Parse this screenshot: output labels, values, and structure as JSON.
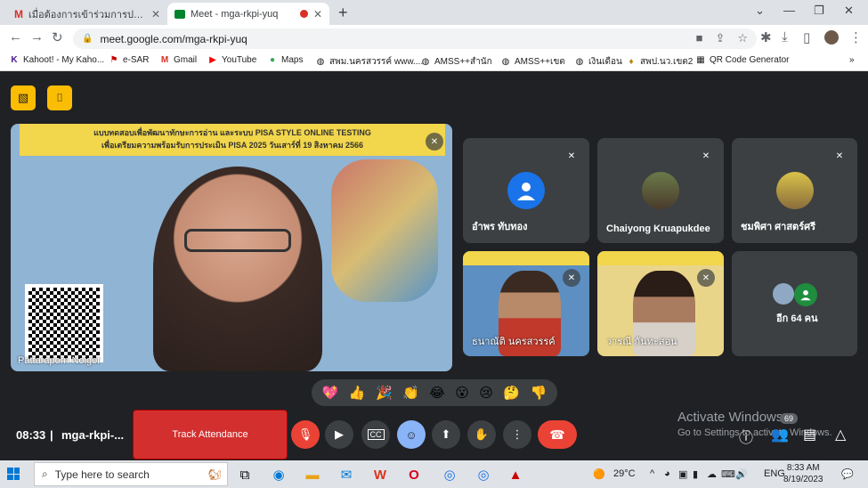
{
  "browser": {
    "tabs": [
      {
        "title": "เมื่อต้องการเข้าร่วมการประชุมทางวิดีโอ",
        "icon": "gmail-icon",
        "active": false
      },
      {
        "title": "Meet - mga-rkpi-yuq",
        "icon": "meet-icon",
        "active": true
      }
    ],
    "url": "meet.google.com/mga-rkpi-yuq",
    "bookmarks": [
      {
        "label": "Kahoot! - My Kaho..."
      },
      {
        "label": "e-SAR"
      },
      {
        "label": "Gmail"
      },
      {
        "label": "YouTube"
      },
      {
        "label": "Maps"
      },
      {
        "label": "สพม.นครสวรรค์ www...."
      },
      {
        "label": "AMSS++สำนัก"
      },
      {
        "label": "AMSS++เขต"
      },
      {
        "label": "เงินเดือน"
      },
      {
        "label": "สพป.นว.เขต2"
      },
      {
        "label": "QR Code Generator"
      }
    ]
  },
  "meeting": {
    "banner_line1": "แบบทดสอบเพื่อพัฒนาทักษะการอ่าน และระบบ PISA STYLE ONLINE TESTING",
    "banner_line2": "เพื่อเตรียมความพร้อมรับการประเมิน PISA 2025 วันเสาร์ที่ 19 สิงหาคม 2566",
    "main_speaker": "Pattaraporn Noigor",
    "participants": [
      {
        "name": "อำพร ทับทอง",
        "type": "avatar",
        "color": "#1a73e8"
      },
      {
        "name": "Chaiyong Kruapukdee",
        "type": "photo",
        "color": "#7a6a4f"
      },
      {
        "name": "ชมพิศา ศาสตร์ศรี",
        "type": "photo",
        "color": "#c8b85a"
      },
      {
        "name": "ธนาณัติ นครสวรรค์",
        "type": "video"
      },
      {
        "name": "วารณี กันทะสอน",
        "type": "video"
      }
    ],
    "more_label": "อีก 64 คน",
    "reactions": [
      "💖",
      "👍",
      "🎉",
      "👏",
      "😂",
      "😮",
      "😢",
      "🤔",
      "👎"
    ],
    "time": "08:33",
    "meeting_code": "mga-rkpi-...",
    "track_attendance": "Track Attendance",
    "participant_count": "69",
    "activate_title": "Activate Windows",
    "activate_sub": "Go to Settings to activate Windows."
  },
  "taskbar": {
    "search_placeholder": "Type here to search",
    "weather": "29°C",
    "lang": "ENG",
    "time": "8:33 AM",
    "date": "8/19/2023"
  }
}
